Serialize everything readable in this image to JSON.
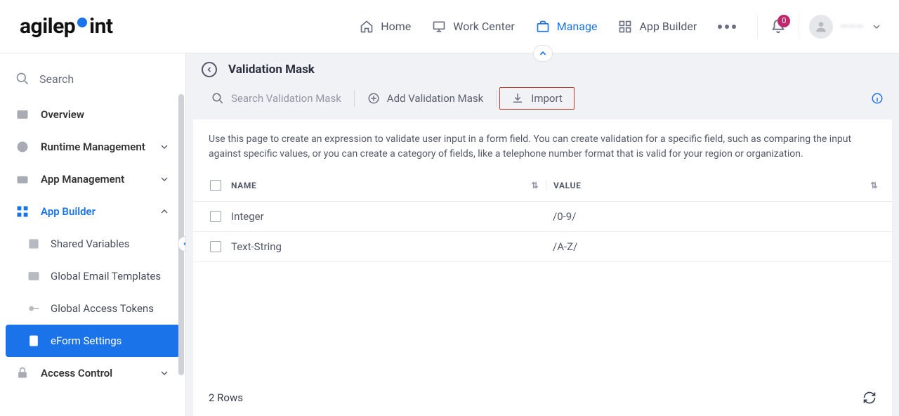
{
  "header": {
    "logo_pre": "agilep",
    "logo_post": "int",
    "nav": {
      "home": "Home",
      "work_center": "Work Center",
      "manage": "Manage",
      "app_builder": "App Builder"
    },
    "notifications_count": "0",
    "user_name": "———"
  },
  "sidebar": {
    "search_placeholder": "Search",
    "items": {
      "overview": "Overview",
      "runtime_management": "Runtime Management",
      "app_management": "App Management",
      "app_builder": "App Builder",
      "access_control": "Access Control"
    },
    "app_builder_subitems": {
      "shared_variables": "Shared Variables",
      "global_email_templates": "Global Email Templates",
      "global_access_tokens": "Global Access Tokens",
      "eform_settings": "eForm Settings"
    }
  },
  "page": {
    "title": "Validation Mask",
    "search_placeholder": "Search Validation Mask",
    "add_label": "Add Validation Mask",
    "import_label": "Import",
    "description": "Use this page to create an expression to validate user input in a form field. You can create validation for a specific field, such as comparing the input against specific values, or you can create a category of fields, like a telephone number format that is valid for your region or organization.",
    "columns": {
      "name": "NAME",
      "value": "VALUE"
    },
    "rows": [
      {
        "name": "Integer",
        "value": "/0-9/"
      },
      {
        "name": "Text-String",
        "value": "/A-Z/"
      }
    ],
    "row_count_label": "2 Rows"
  }
}
